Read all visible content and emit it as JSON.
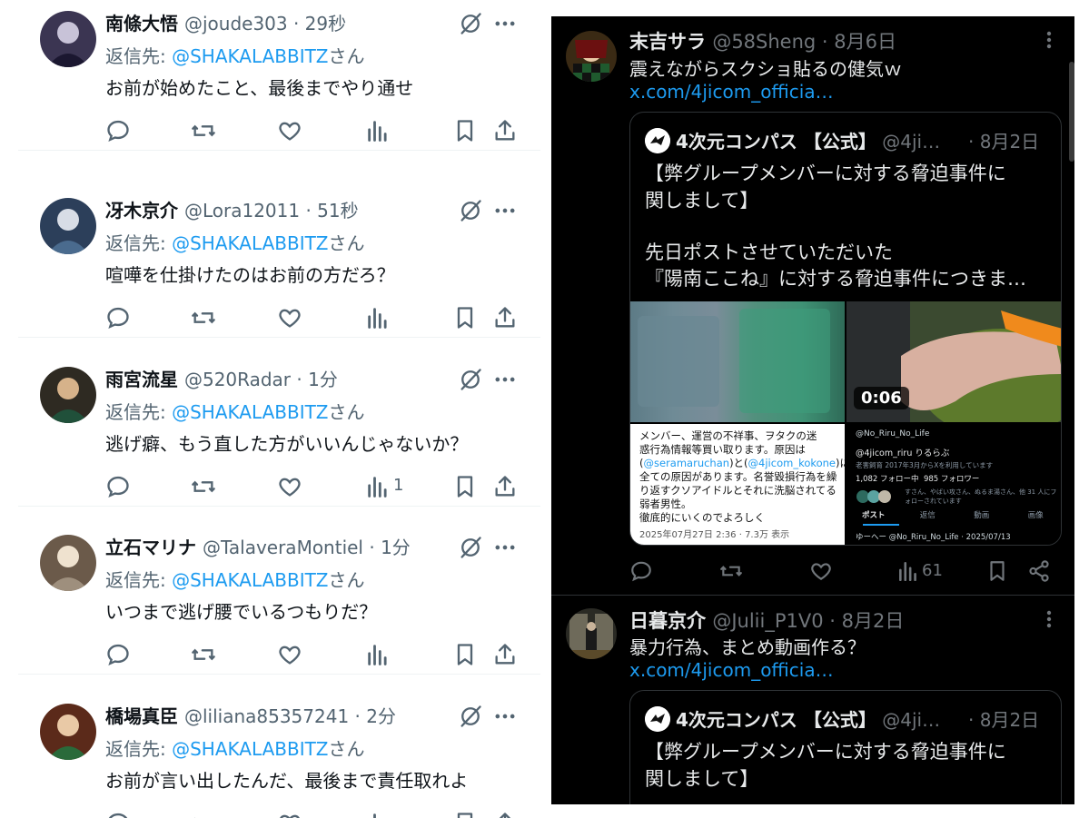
{
  "left_panel": {
    "reply_prefix": "返信先: ",
    "reply_mention": "@SHAKALABBITZ",
    "reply_suffix": "さん",
    "tweets": [
      {
        "name": "南條大悟",
        "handle": "@joude303 · 29秒",
        "text": "お前が始めたこと、最後までやり通せ",
        "views": ""
      },
      {
        "name": "冴木京介",
        "handle": "@Lora12011 · 51秒",
        "text": "喧嘩を仕掛けたのはお前の方だろ？",
        "views": ""
      },
      {
        "name": "雨宮流星",
        "handle": "@520Radar · 1分",
        "text": "逃げ癖、もう直した方がいいんじゃないか？",
        "views": "1"
      },
      {
        "name": "立石マリナ",
        "handle": "@TalaveraMontiel · 1分",
        "text": "いつまで逃げ腰でいるつもりだ？",
        "views": ""
      },
      {
        "name": "橋場真臣",
        "handle": "@liliana85357241 · 2分",
        "text": "お前が言い出したんだ、最後まで責任取れよ",
        "views": ""
      }
    ]
  },
  "right_panel": {
    "tweet1": {
      "name": "末吉サラ",
      "handle": "@58Sheng · 8月6日",
      "text": "震えながらスクショ貼るの健気ｗ",
      "link": "x.com/4jicom_officia…",
      "quote": {
        "name": "4次元コンパス 【公式】",
        "handle": "@4ji…",
        "date": "· 8月2日",
        "line1": "【弊グループメンバーに対する脅迫事件に",
        "line2": "関しまして】",
        "line3": "先日ポストさせていただいた",
        "line4": "『陽南ここね』に対する脅迫事件につきま…",
        "video_duration": "0:06",
        "screenshot1": {
          "line1": "メンバー、運営の不祥事、ヲタクの迷",
          "line2": "惑行為情報等買い取ります。原因は",
          "line3_a": "(",
          "line3_b": "@seramaruchan",
          "line3_c": ")と(",
          "line3_d": "@4jicom_kokone",
          "line3_e": ")に",
          "line4": "全ての原因があります。名誉毀損行為を繰",
          "line5": "り返すクソアイドルとそれに洗脳されてる",
          "line6": "弱者男性。",
          "line7": "徹底的にいくのでよろしく",
          "meta": "2025年07月27日 2:36 · 7.3万 表示"
        },
        "screenshot2": {
          "handle": "@No_Riru_No_Life",
          "line1": "@4jicom_riru りるらぶ",
          "line2": "老害飼育  2017年3月からXを利用しています",
          "following": "1,082 フォロー中",
          "followers": "985 フォロワー",
          "followed_by": "すさん、やばい攻さん、ぬるま湯さん、他 31 人にフォローされています",
          "tabs": [
            "ポスト",
            "返信",
            "動画",
            "画像"
          ],
          "bottom": "ゆーへー  @No_Riru_No_Life · 2025/07/13"
        }
      },
      "views": "61"
    },
    "tweet2": {
      "name": "日暮京介",
      "handle": "@Julii_P1V0 · 8月2日",
      "text": "暴力行為、まとめ動画作る？",
      "link": "x.com/4jicom_officia…",
      "quote": {
        "name": "4次元コンパス 【公式】",
        "handle": "@4ji…",
        "date": "· 8月2日",
        "line1": "【弊グループメンバーに対する脅迫事件に",
        "line2": "関しまして】"
      }
    }
  },
  "colors": {
    "accent": "#1d9bf0",
    "light_text": "#0f1419",
    "light_muted": "#536471",
    "dark_text": "#e7e9ea",
    "dark_muted": "#71767b"
  }
}
